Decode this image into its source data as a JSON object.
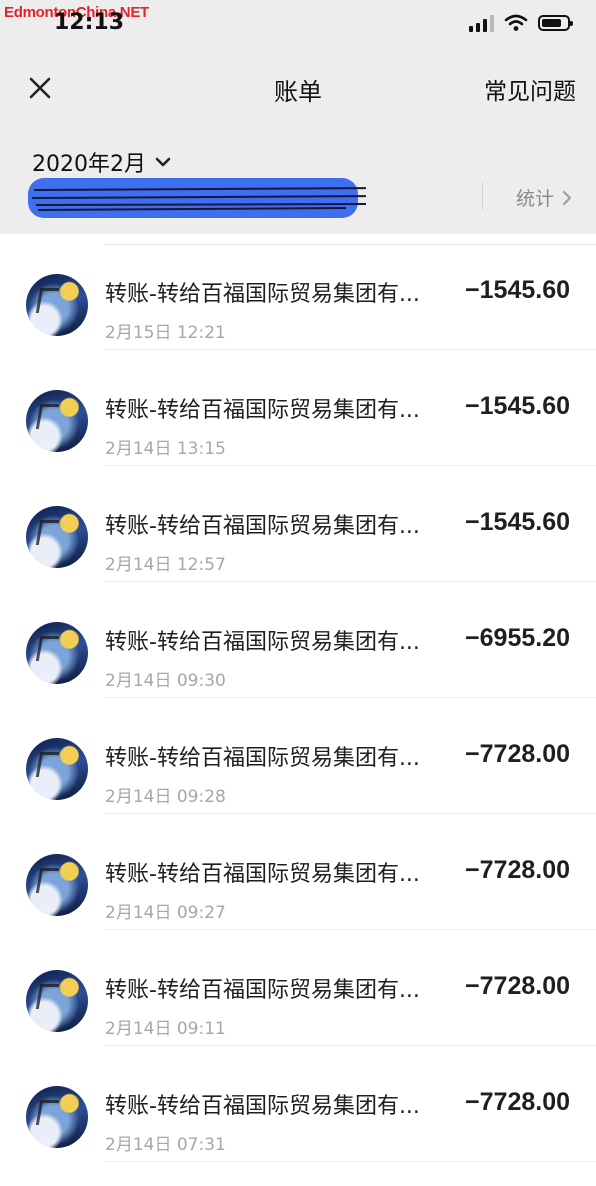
{
  "watermark": "EdmontonChina.NET",
  "status_bar": {
    "time": "12:13",
    "icons": [
      "cellular-signal-icon",
      "wifi-icon",
      "battery-icon"
    ]
  },
  "nav": {
    "title": "账单",
    "faq_label": "常见问题",
    "close_icon": "close-icon"
  },
  "filter": {
    "month": "2020年2月",
    "stats_label": "统计"
  },
  "transactions": [
    {
      "title": "转账-转给百福国际贸易集团有...",
      "time": "2月15日 12:21",
      "amount": "−1545.60"
    },
    {
      "title": "转账-转给百福国际贸易集团有...",
      "time": "2月14日 13:15",
      "amount": "−1545.60"
    },
    {
      "title": "转账-转给百福国际贸易集团有...",
      "time": "2月14日 12:57",
      "amount": "−1545.60"
    },
    {
      "title": "转账-转给百福国际贸易集团有...",
      "time": "2月14日 09:30",
      "amount": "−6955.20"
    },
    {
      "title": "转账-转给百福国际贸易集团有...",
      "time": "2月14日 09:28",
      "amount": "−7728.00"
    },
    {
      "title": "转账-转给百福国际贸易集团有...",
      "time": "2月14日 09:27",
      "amount": "−7728.00"
    },
    {
      "title": "转账-转给百福国际贸易集团有...",
      "time": "2月14日 09:11",
      "amount": "−7728.00"
    },
    {
      "title": "转账-转给百福国际贸易集团有...",
      "time": "2月14日 07:31",
      "amount": "−7728.00"
    }
  ],
  "colors": {
    "header_bg": "#ededed",
    "watermark": "#e0242b",
    "redaction": "#3e6ff0",
    "muted_text": "#a7a7a7"
  }
}
